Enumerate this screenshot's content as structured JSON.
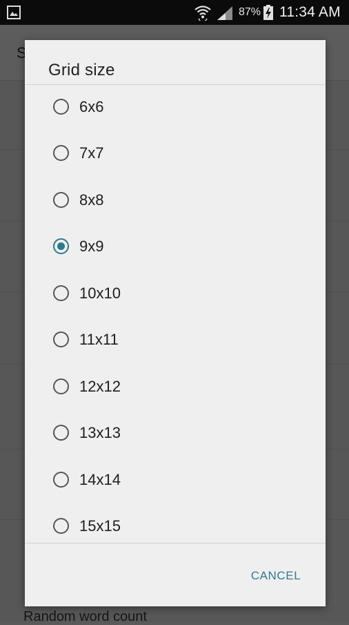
{
  "status_bar": {
    "battery": "87%",
    "time": "11:34 AM",
    "icons": [
      "gallery-icon",
      "wifi-icon",
      "signal-icon",
      "battery-charging-icon"
    ]
  },
  "background": {
    "title": "S",
    "bottom_item": "Random word count"
  },
  "dialog": {
    "title": "Grid size",
    "options": [
      {
        "label": "6x6",
        "checked": false
      },
      {
        "label": "7x7",
        "checked": false
      },
      {
        "label": "8x8",
        "checked": false
      },
      {
        "label": "9x9",
        "checked": true
      },
      {
        "label": "10x10",
        "checked": false
      },
      {
        "label": "11x11",
        "checked": false
      },
      {
        "label": "12x12",
        "checked": false
      },
      {
        "label": "13x13",
        "checked": false
      },
      {
        "label": "14x14",
        "checked": false
      },
      {
        "label": "15x15",
        "checked": false
      }
    ],
    "cancel_label": "CANCEL"
  },
  "colors": {
    "accent": "#2c7a8c",
    "dialog_bg": "#efefef",
    "scrim": "#575757"
  }
}
